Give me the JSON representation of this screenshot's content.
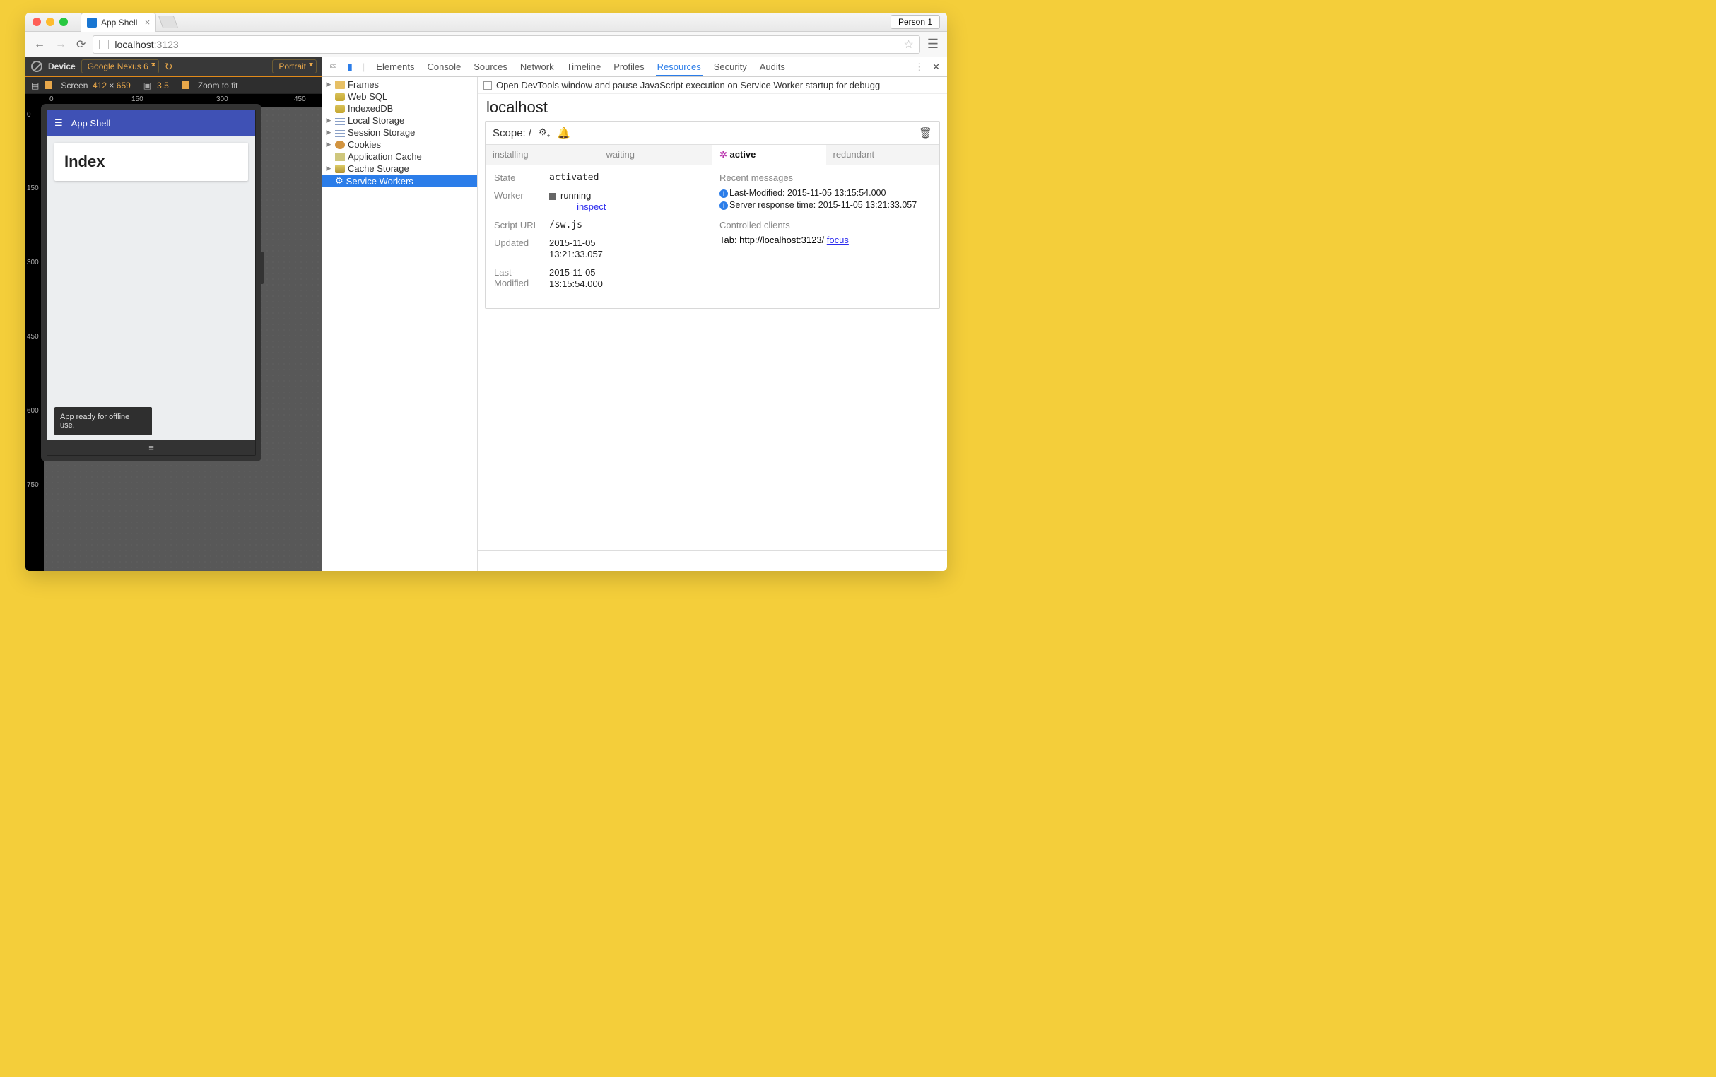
{
  "browser": {
    "tab_title": "App Shell",
    "person": "Person 1",
    "url_host": "localhost",
    "url_port": ":3123"
  },
  "device_mode": {
    "device_label": "Device",
    "device_value": "Google Nexus 6",
    "orientation": "Portrait",
    "screen_label": "Screen",
    "width": "412",
    "height": "659",
    "dpr": "3.5",
    "zoom_label": "Zoom to fit",
    "ruler_top": [
      "0",
      "150",
      "300",
      "450"
    ],
    "ruler_left": [
      "0",
      "150",
      "300",
      "450",
      "600",
      "750"
    ]
  },
  "preview_app": {
    "title": "App Shell",
    "card_heading": "Index",
    "toast": "App ready for offline use."
  },
  "devtools": {
    "tabs": [
      "Elements",
      "Console",
      "Sources",
      "Network",
      "Timeline",
      "Profiles",
      "Resources",
      "Security",
      "Audits"
    ],
    "active_tab": "Resources",
    "option_text": "Open DevTools window and pause JavaScript execution on Service Worker startup for debugg",
    "host": "localhost"
  },
  "resource_tree": [
    {
      "label": "Frames",
      "icon": "folder",
      "expand": true
    },
    {
      "label": "Web SQL",
      "icon": "db"
    },
    {
      "label": "IndexedDB",
      "icon": "db"
    },
    {
      "label": "Local Storage",
      "icon": "grid",
      "expand": true
    },
    {
      "label": "Session Storage",
      "icon": "grid",
      "expand": true
    },
    {
      "label": "Cookies",
      "icon": "cookie",
      "expand": true
    },
    {
      "label": "Application Cache",
      "icon": "app"
    },
    {
      "label": "Cache Storage",
      "icon": "stack",
      "expand": true
    },
    {
      "label": "Service Workers",
      "icon": "gear",
      "selected": true
    }
  ],
  "scope": {
    "label": "Scope:",
    "path": "/"
  },
  "sw_tabs": [
    "installing",
    "waiting",
    "active",
    "redundant"
  ],
  "sw_active": "active",
  "sw_detail": {
    "state_k": "State",
    "state_v": "activated",
    "worker_k": "Worker",
    "worker_status": "running",
    "worker_link": "inspect",
    "scripturl_k": "Script URL",
    "scripturl_v": "/sw.js",
    "updated_k": "Updated",
    "updated_v1": "2015-11-05",
    "updated_v2": "13:21:33.057",
    "lastmod_k": "Last-Modified",
    "lastmod_v1": "2015-11-05",
    "lastmod_v2": "13:15:54.000"
  },
  "messages": {
    "heading": "Recent messages",
    "m1": "Last-Modified: 2015-11-05 13:15:54.000",
    "m2": "Server response time: 2015-11-05 13:21:33.057",
    "clients_heading": "Controlled clients",
    "client_prefix": "Tab: http://localhost:3123/ ",
    "client_link": "focus"
  }
}
